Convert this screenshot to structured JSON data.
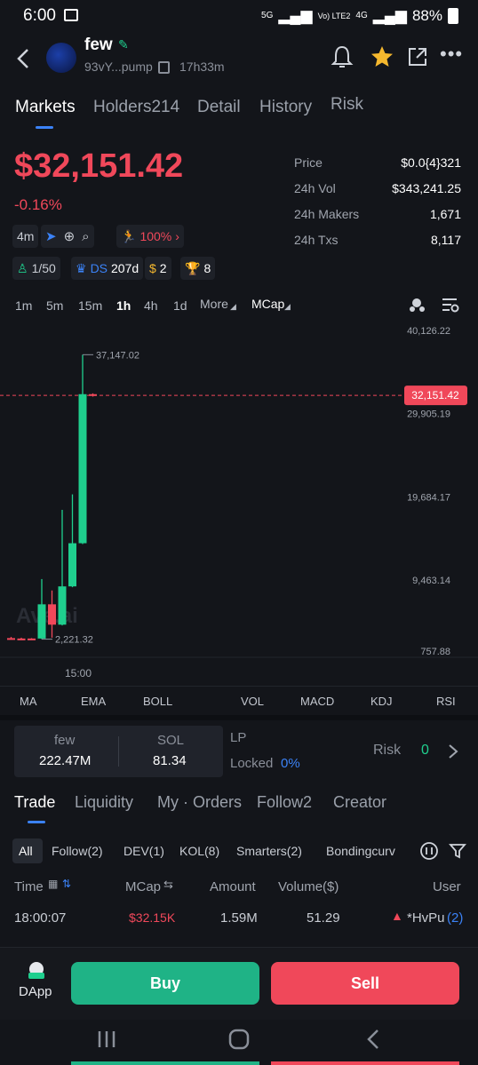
{
  "status_bar": {
    "time": "6:00",
    "network": "5G",
    "lte": "Vo) LTE2",
    "net2": "4G",
    "battery": "88%"
  },
  "token": {
    "name": "few",
    "address": "93vY...pump",
    "age": "17h33m"
  },
  "tabs": [
    "Markets",
    "Holders214",
    "Detail",
    "History",
    "Risk"
  ],
  "price": {
    "main": "$32,151.42",
    "change": "-0.16%"
  },
  "stats": [
    {
      "key": "Price",
      "value": "$0.0{4}321"
    },
    {
      "key": "24h Vol",
      "value": "$343,241.25"
    },
    {
      "key": "24h Makers",
      "value": "1,671"
    },
    {
      "key": "24h Txs",
      "value": "8,117"
    }
  ],
  "badges": {
    "age": "4m",
    "boost": "100%",
    "holders": "1/50",
    "ds": "DS",
    "ds_age": "207d",
    "bags": "2",
    "trophy": "8"
  },
  "timeframes": [
    "1m",
    "5m",
    "15m",
    "1h",
    "4h",
    "1d",
    "More",
    "MCap"
  ],
  "chart_data": {
    "type": "candlestick",
    "y_ticks": [
      "40,126.22",
      "29,905.19",
      "19,684.17",
      "9,463.14",
      "757.88"
    ],
    "y_tick_values": [
      40126.22,
      29905.19,
      19684.17,
      9463.14,
      757.88
    ],
    "ylim": [
      757.88,
      40126.22
    ],
    "x_label": "15:00",
    "current_price_label": "32,151.42",
    "current_price": 32151.42,
    "high_label": "37,147.02",
    "high": 37147.02,
    "low_label": "2,221.32",
    "low": 2221.32,
    "watermark": "Ave.ai",
    "candles": [
      {
        "o": 2350,
        "h": 2500,
        "l": 2300,
        "c": 2280,
        "color": "#f0485a"
      },
      {
        "o": 2300,
        "h": 2400,
        "l": 2221.32,
        "c": 2260,
        "color": "#f0485a"
      },
      {
        "o": 2260,
        "h": 2350,
        "l": 2221.32,
        "c": 2300,
        "color": "#f0485a"
      },
      {
        "o": 2300,
        "h": 9600,
        "l": 2221.32,
        "c": 6500,
        "color": "#1fcf8e"
      },
      {
        "o": 6500,
        "h": 8200,
        "l": 2400,
        "c": 4000,
        "color": "#f0485a"
      },
      {
        "o": 4000,
        "h": 18100,
        "l": 3900,
        "c": 8700,
        "color": "#1fcf8e"
      },
      {
        "o": 8700,
        "h": 20000,
        "l": 8600,
        "c": 14000,
        "color": "#1fcf8e"
      },
      {
        "o": 14000,
        "h": 37147.02,
        "l": 13900,
        "c": 32300,
        "color": "#1fcf8e"
      },
      {
        "o": 32300,
        "h": 32400,
        "l": 32000,
        "c": 32151.42,
        "color": "#f0485a"
      }
    ]
  },
  "indicators": [
    "MA",
    "EMA",
    "BOLL",
    "VOL",
    "MACD",
    "KDJ",
    "RSI"
  ],
  "pool": {
    "base_label": "few",
    "base_value": "222.47M",
    "quote_label": "SOL",
    "quote_value": "81.34",
    "lp_label": "LP",
    "locked_label": "Locked",
    "locked_value": "0%",
    "risk_label": "Risk",
    "risk_value": "0"
  },
  "trade_tabs": [
    "Trade",
    "Liquidity",
    "My · Orders",
    "Follow2",
    "Creator"
  ],
  "filters": [
    "All",
    "Follow(2)",
    "DEV(1)",
    "KOL(8)",
    "Smarters(2)",
    "Bondingcurv"
  ],
  "table": {
    "headers": [
      "Time",
      "MCap",
      "Amount",
      "Volume($)",
      "User"
    ],
    "rows": [
      {
        "time": "18:00:07",
        "mcap": "$32.15K",
        "amount": "1.59M",
        "volume": "51.29",
        "user": "*HvPu",
        "user_count": "(2)"
      }
    ]
  },
  "bottom": {
    "dapp": "DApp",
    "buy": "Buy",
    "sell": "Sell"
  },
  "colors": {
    "green": "#1fcf8e",
    "red": "#f0485a",
    "blue": "#3b82f6",
    "gold": "#f5b82e"
  }
}
